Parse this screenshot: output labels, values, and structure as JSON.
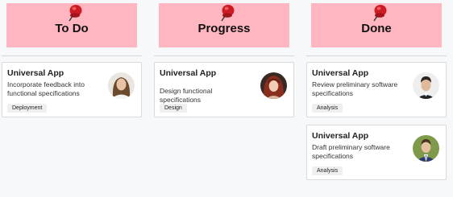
{
  "board": {
    "columns": [
      {
        "title": "To Do",
        "cards": [
          {
            "title": "Universal App",
            "description": "Incorporate feedback into functional specifications",
            "tag": "Deployment",
            "avatar": "woman-smiling-avatar"
          }
        ]
      },
      {
        "title": "Progress",
        "cards": [
          {
            "title": "Universal App",
            "description": "Design functional specifications",
            "tag": "Design",
            "avatar": "woman-red-hair-avatar"
          }
        ]
      },
      {
        "title": "Done",
        "cards": [
          {
            "title": "Universal App",
            "description": "Review preliminary software specifications",
            "tag": "Analysis",
            "avatar": "man-dark-hair-avatar"
          },
          {
            "title": "Universal App",
            "description": "Draft preliminary software specifications",
            "tag": "Analysis",
            "avatar": "man-suit-avatar"
          }
        ]
      }
    ]
  },
  "colors": {
    "header_background": "#ffb6c1",
    "pin": "#cc1b22",
    "card_border": "#dadada",
    "tag_background": "#efefef"
  },
  "icons": {
    "column_header_pin": "pushpin-icon"
  }
}
